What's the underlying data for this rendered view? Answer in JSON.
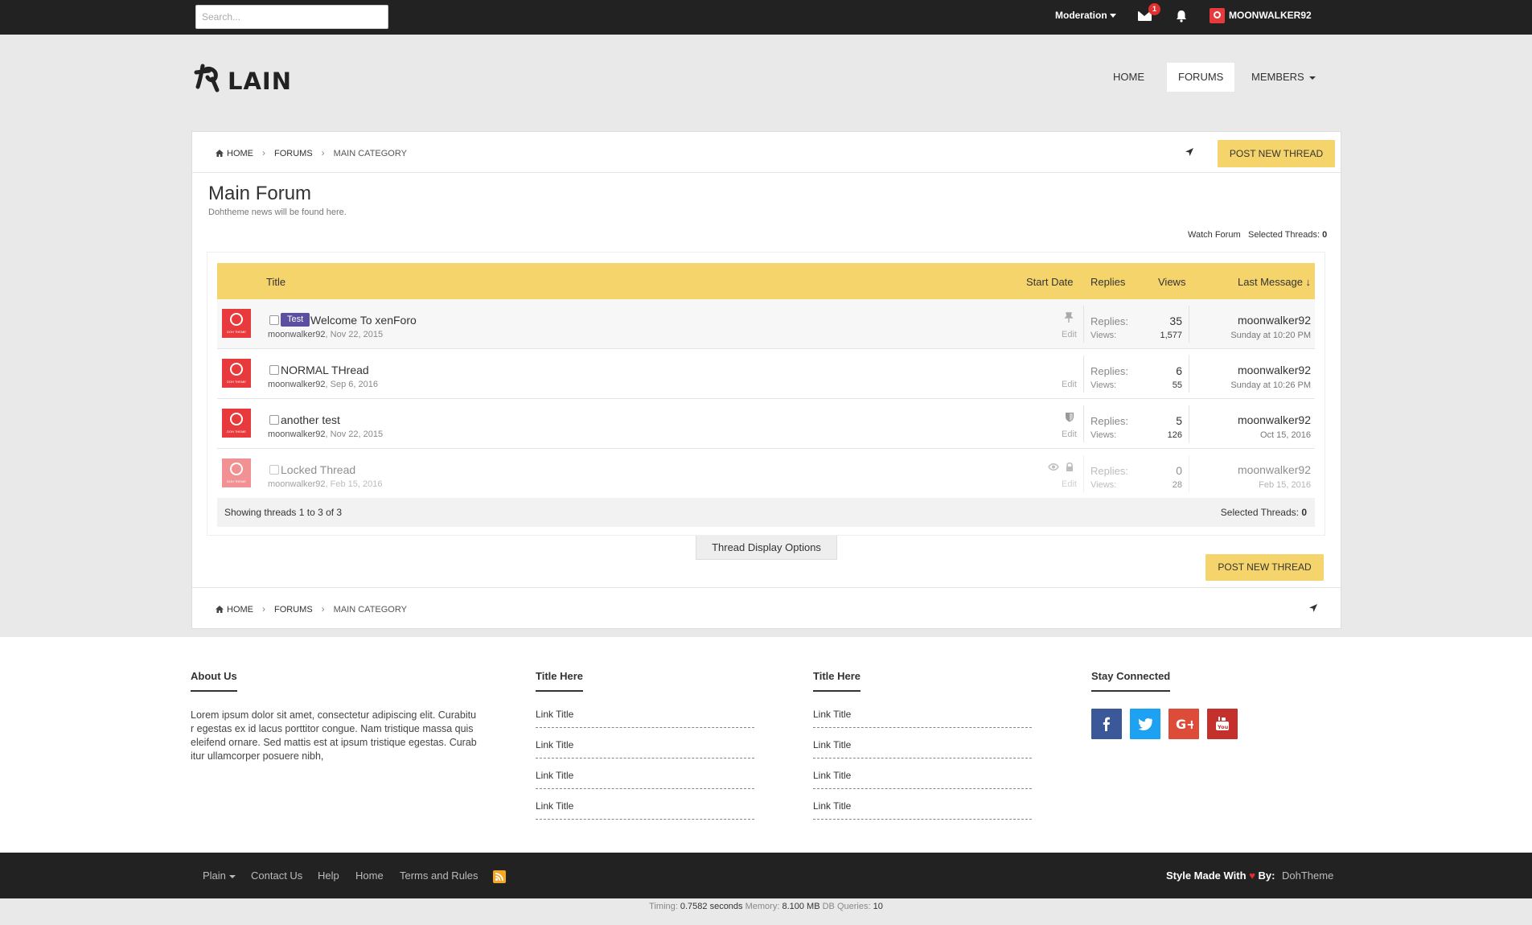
{
  "topbar": {
    "search_placeholder": "Search...",
    "moderation": "Moderation",
    "inbox_count": "1",
    "username": "MOONWALKER92"
  },
  "header": {
    "logo_text": "LAIN",
    "nav": [
      "HOME",
      "FORUMS",
      "MEMBERS"
    ],
    "active_nav": "FORUMS"
  },
  "breadcrumb": {
    "items": [
      "HOME",
      "FORUMS",
      "MAIN CATEGORY"
    ]
  },
  "forum": {
    "post_button": "POST NEW THREAD",
    "title": "Main Forum",
    "description": "Dohtheme news will be found here.",
    "watch": "Watch Forum",
    "selected_label": "Selected Threads:",
    "selected_count": "0"
  },
  "table": {
    "headers": {
      "title": "Title",
      "start_date": "Start Date",
      "replies": "Replies",
      "views": "Views",
      "last_message": "Last Message ↓"
    },
    "replies_label": "Replies:",
    "views_label": "Views:",
    "edit_label": "Edit",
    "threads": [
      {
        "prefix": "Test",
        "title": "Welcome To xenForo",
        "author": "moonwalker92",
        "date": "Nov 22, 2015",
        "replies": "35",
        "views": "1,577",
        "last_user": "moonwalker92",
        "last_date": "Sunday at 10:20 PM",
        "icon": "pin-icon"
      },
      {
        "prefix": "",
        "title": "NORMAL THread",
        "author": "moonwalker92",
        "date": "Sep 6, 2016",
        "replies": "6",
        "views": "55",
        "last_user": "moonwalker92",
        "last_date": "Sunday at 10:26 PM",
        "icon": ""
      },
      {
        "prefix": "",
        "title": "another test",
        "author": "moonwalker92",
        "date": "Nov 22, 2015",
        "replies": "5",
        "views": "126",
        "last_user": "moonwalker92",
        "last_date": "Oct 15, 2016",
        "icon": "shield-icon"
      },
      {
        "prefix": "",
        "title": "Locked Thread",
        "author": "moonwalker92",
        "date": "Feb 15, 2016",
        "replies": "0",
        "views": "28",
        "last_user": "moonwalker92",
        "last_date": "Feb 15, 2016",
        "icon": "eye-lock-icons"
      }
    ],
    "showing": "Showing threads 1 to 3 of 3",
    "display_options": "Thread Display Options"
  },
  "footer": {
    "about_title": "About Us",
    "about_text": "Lorem ipsum dolor sit amet, consectetur adipiscing elit. Curabitur egestas ex id lacus porttitor congue. Nam tristique massa quis eleifend ornare. Sed mattis est at ipsum tristique egestas. Curabitur ullamcorper posuere nibh,",
    "col2_title": "Title Here",
    "col3_title": "Title Here",
    "link_title": "Link Title",
    "social_title": "Stay Connected",
    "colors": {
      "facebook": "#3b5998",
      "twitter": "#1da1f2",
      "google": "#dd4b39",
      "youtube": "#c4302b"
    }
  },
  "bottom_bar": {
    "links": [
      "Plain",
      "Contact Us",
      "Help",
      "Home",
      "Terms and Rules"
    ],
    "made_with": "Style Made With",
    "by": "By:",
    "author": "DohTheme"
  },
  "debug": {
    "timing_label": "Timing:",
    "timing_value": "0.7582 seconds",
    "memory_label": "Memory:",
    "memory_value": "8.100 MB",
    "db_label": "DB Queries:",
    "db_value": "10"
  },
  "accent": "#f5d56b"
}
